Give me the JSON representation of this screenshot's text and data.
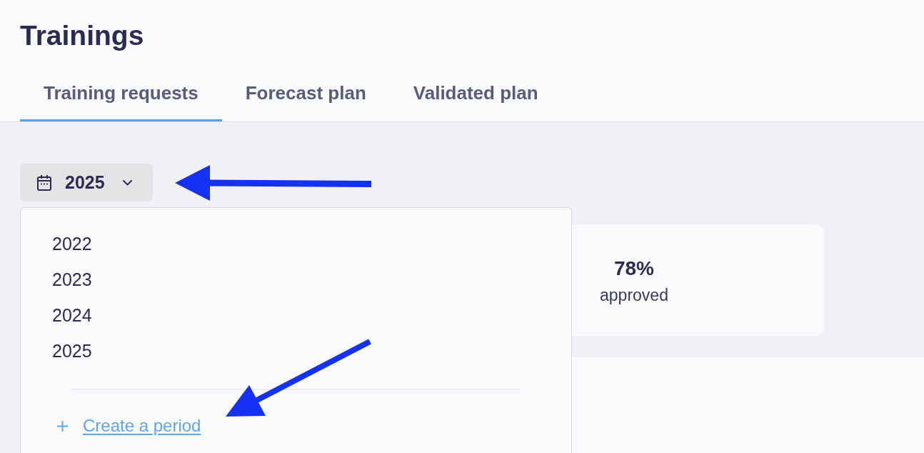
{
  "page": {
    "title": "Trainings"
  },
  "tabs": [
    {
      "label": "Training requests",
      "selected": true
    },
    {
      "label": "Forecast plan",
      "selected": false
    },
    {
      "label": "Validated plan",
      "selected": false
    }
  ],
  "period_selector": {
    "value": "2025",
    "expanded": true
  },
  "period_menu": {
    "options": [
      {
        "label": "2022"
      },
      {
        "label": "2023"
      },
      {
        "label": "2024"
      },
      {
        "label": "2025"
      }
    ],
    "create_link": {
      "label": "Create a period"
    }
  },
  "stats": [
    {
      "value": "78%",
      "label": "approved"
    }
  ]
}
